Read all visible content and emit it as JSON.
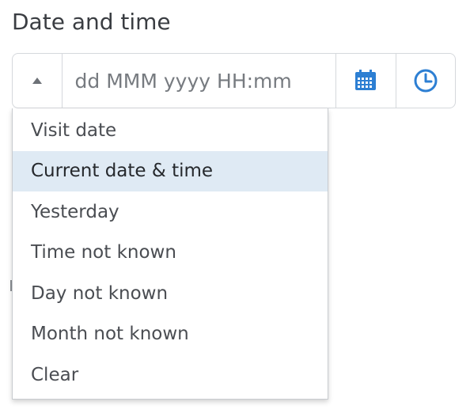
{
  "field": {
    "label": "Date and time",
    "placeholder": "dd MMM yyyy HH:mm",
    "value": ""
  },
  "icons": {
    "toggle": "caret-up-icon",
    "calendar": "calendar-icon",
    "clock": "clock-icon"
  },
  "menu": {
    "items": [
      {
        "label": "Visit date"
      },
      {
        "label": "Current date & time"
      },
      {
        "label": "Yesterday"
      },
      {
        "label": "Time not known"
      },
      {
        "label": "Day not known"
      },
      {
        "label": "Month not known"
      },
      {
        "label": "Clear"
      }
    ],
    "highlighted": "Current date & time"
  },
  "colors": {
    "accent": "#2d7fd3",
    "highlight_bg": "#dfeaf4",
    "border": "#d5d8dc"
  }
}
